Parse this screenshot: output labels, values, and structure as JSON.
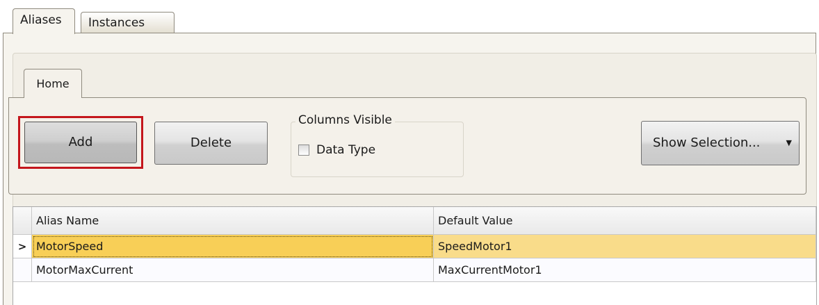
{
  "outer_tabs": [
    "Aliases",
    "Instances"
  ],
  "ribbon": {
    "tab": "Home",
    "add_label": "Add",
    "delete_label": "Delete",
    "columns_group_title": "Columns Visible",
    "data_type_label": "Data Type",
    "data_type_checked": false,
    "show_selection_label": "Show Selection..."
  },
  "grid": {
    "headers": [
      "Alias Name",
      "Default Value"
    ],
    "rows": [
      {
        "alias": "MotorSpeed",
        "default": "SpeedMotor1",
        "selected": true
      },
      {
        "alias": "MotorMaxCurrent",
        "default": "MaxCurrentMotor1",
        "selected": false
      }
    ]
  },
  "colors": {
    "selected_row": "#f9dc8a",
    "selected_cell": "#f8cf57",
    "highlight_box": "#c4161c"
  }
}
